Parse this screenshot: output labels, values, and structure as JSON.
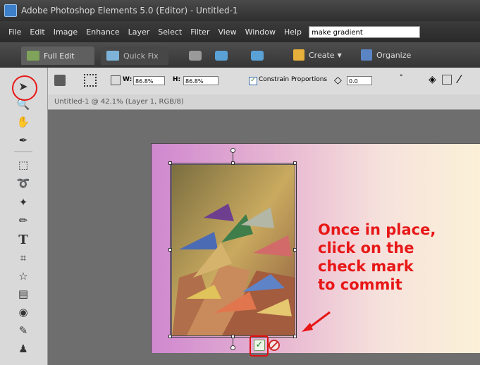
{
  "window": {
    "title": "Adobe Photoshop Elements 5.0 (Editor) - Untitled-1"
  },
  "menu": {
    "items": [
      "File",
      "Edit",
      "Image",
      "Enhance",
      "Layer",
      "Select",
      "Filter",
      "View",
      "Window",
      "Help"
    ],
    "help_search_value": "make gradient"
  },
  "modes": {
    "full_edit": "Full Edit",
    "quick_fix": "Quick Fix",
    "create": "Create",
    "organize": "Organize"
  },
  "options": {
    "w_label": "W:",
    "w_value": "86.8%",
    "h_label": "H:",
    "h_value": "86.8%",
    "constrain_label": "Constrain Proportions",
    "angle_value": "0.0",
    "angle_unit": "°"
  },
  "document": {
    "tab_title": "Untitled-1 @ 42.1% (Layer 1, RGB/8)"
  },
  "annotation": {
    "text": "Once in place,\nclick on the\ncheck mark\nto commit"
  },
  "colors": {
    "annotation_red": "#e81717",
    "gradient_left": "#cf87cf",
    "gradient_right": "#fbf1d7"
  },
  "icons": [
    "move-tool-icon",
    "zoom-tool-icon",
    "hand-tool-icon",
    "eyedropper-icon",
    "marquee-icon",
    "lasso-icon",
    "magic-wand-icon",
    "brush-icon",
    "type-tool-icon",
    "crop-icon",
    "cookie-cutter-icon",
    "straighten-icon",
    "red-eye-icon",
    "healing-brush-icon",
    "clone-stamp-icon",
    "commit-check-icon",
    "cancel-icon"
  ]
}
